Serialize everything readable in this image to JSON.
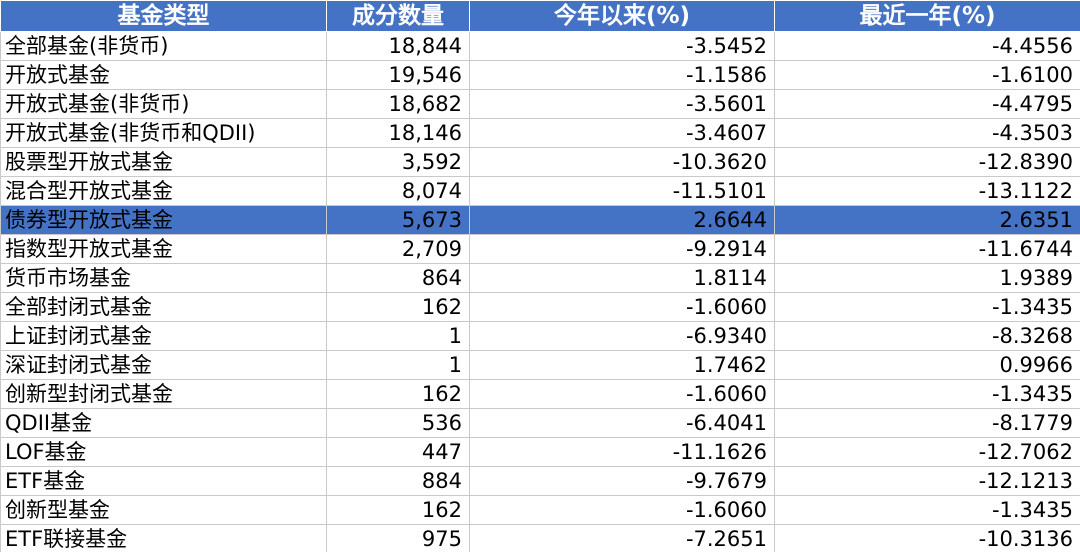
{
  "table": {
    "headers": [
      "基金类型",
      "成分数量",
      "今年以来(%)",
      "最近一年(%)"
    ],
    "rows": [
      {
        "name": "全部基金(非货币)",
        "count": "18,844",
        "ytd": "-3.5452",
        "year": "-4.4556"
      },
      {
        "name": "开放式基金",
        "count": "19,546",
        "ytd": "-1.1586",
        "year": "-1.6100"
      },
      {
        "name": "开放式基金(非货币)",
        "count": "18,682",
        "ytd": "-3.5601",
        "year": "-4.4795"
      },
      {
        "name": "开放式基金(非货币和QDII)",
        "count": "18,146",
        "ytd": "-3.4607",
        "year": "-4.3503"
      },
      {
        "name": "股票型开放式基金",
        "count": "3,592",
        "ytd": "-10.3620",
        "year": "-12.8390"
      },
      {
        "name": "混合型开放式基金",
        "count": "8,074",
        "ytd": "-11.5101",
        "year": "-13.1122"
      },
      {
        "name": "债券型开放式基金",
        "count": "5,673",
        "ytd": "2.6644",
        "year": "2.6351",
        "highlighted": true
      },
      {
        "name": "指数型开放式基金",
        "count": "2,709",
        "ytd": "-9.2914",
        "year": "-11.6744"
      },
      {
        "name": "货币市场基金",
        "count": "864",
        "ytd": "1.8114",
        "year": "1.9389"
      },
      {
        "name": "全部封闭式基金",
        "count": "162",
        "ytd": "-1.6060",
        "year": "-1.3435"
      },
      {
        "name": "上证封闭式基金",
        "count": "1",
        "ytd": "-6.9340",
        "year": "-8.3268"
      },
      {
        "name": "深证封闭式基金",
        "count": "1",
        "ytd": "1.7462",
        "year": "0.9966"
      },
      {
        "name": "创新型封闭式基金",
        "count": "162",
        "ytd": "-1.6060",
        "year": "-1.3435"
      },
      {
        "name": "QDII基金",
        "count": "536",
        "ytd": "-6.4041",
        "year": "-8.1779"
      },
      {
        "name": "LOF基金",
        "count": "447",
        "ytd": "-11.1626",
        "year": "-12.7062"
      },
      {
        "name": "ETF基金",
        "count": "884",
        "ytd": "-9.7679",
        "year": "-12.1213"
      },
      {
        "name": "创新型基金",
        "count": "162",
        "ytd": "-1.6060",
        "year": "-1.3435"
      },
      {
        "name": "ETF联接基金",
        "count": "975",
        "ytd": "-7.2651",
        "year": "-10.3136"
      }
    ]
  },
  "colors": {
    "header_bg": "#4472c4",
    "header_text": "#ffffff",
    "highlight_bg": "#4472c4",
    "grid": "#c9c9c9"
  }
}
